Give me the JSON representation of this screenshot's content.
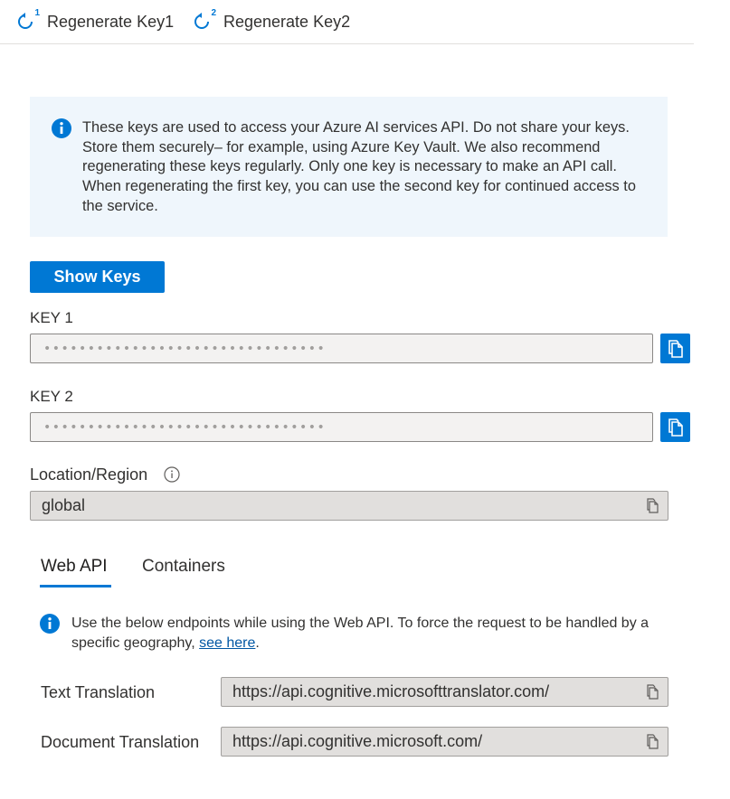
{
  "toolbar": {
    "regen_key1": "Regenerate Key1",
    "regen_key1_num": "1",
    "regen_key2": "Regenerate Key2",
    "regen_key2_num": "2"
  },
  "banner": {
    "text": "These keys are used to access your Azure AI services API. Do not share your keys. Store them securely– for example, using Azure Key Vault. We also recommend regenerating these keys regularly. Only one key is necessary to make an API call. When regenerating the first key, you can use the second key for continued access to the service."
  },
  "show_keys_label": "Show Keys",
  "key1": {
    "label": "KEY 1",
    "value": "••••••••••••••••••••••••••••••••"
  },
  "key2": {
    "label": "KEY 2",
    "value": "••••••••••••••••••••••••••••••••"
  },
  "location": {
    "label": "Location/Region",
    "value": "global"
  },
  "tabs": [
    {
      "label": "Web API",
      "active": true
    },
    {
      "label": "Containers",
      "active": false
    }
  ],
  "webapi": {
    "info_text": "Use the below endpoints while using the Web API. To force the request to be handled by a specific geography, ",
    "info_link": "see here",
    "info_end": ".",
    "endpoints": [
      {
        "label": "Text Translation",
        "url": "https://api.cognitive.microsofttranslator.com/"
      },
      {
        "label": "Document Translation",
        "url": "https://api.cognitive.microsoft.com/"
      }
    ]
  },
  "colors": {
    "accent": "#0078d4",
    "banner_bg": "#eff6fc"
  },
  "icons": {
    "regenerate": "regenerate-icon",
    "info": "info-icon",
    "copy": "copy-icon"
  }
}
